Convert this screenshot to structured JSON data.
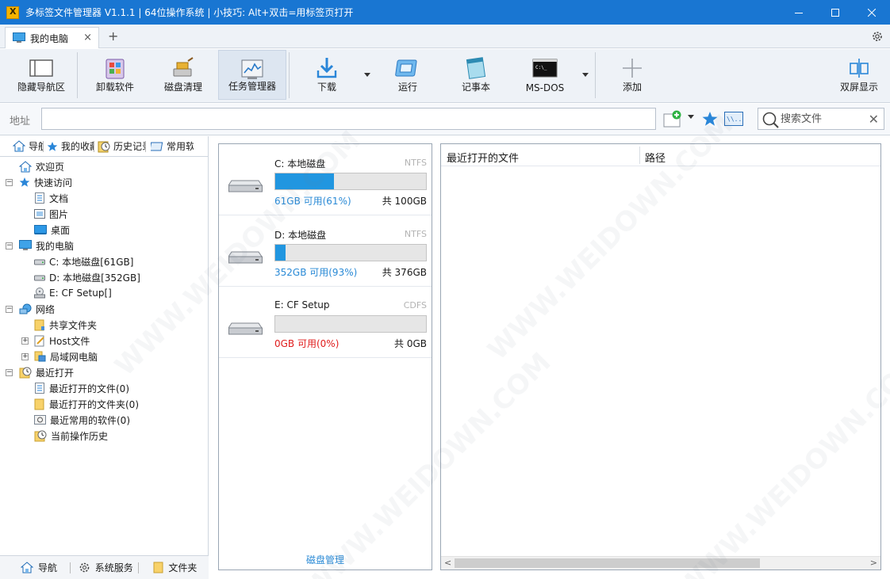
{
  "window": {
    "title": "多标签文件管理器 V1.1.1 | 64位操作系统 | 小技巧: Alt+双击=用标签页打开"
  },
  "tabs": [
    {
      "label": "我的电脑",
      "icon": "computer-icon",
      "close": "×"
    }
  ],
  "tab_add": "+",
  "toolbar": {
    "items": [
      {
        "label": "隐藏导航区",
        "icon": "hide-nav-icon"
      },
      {
        "label": "卸载软件",
        "icon": "uninstall-icon"
      },
      {
        "label": "磁盘清理",
        "icon": "disk-cleanup-icon"
      },
      {
        "label": "任务管理器",
        "icon": "task-manager-icon"
      },
      {
        "label": "下载",
        "icon": "download-icon"
      },
      {
        "label": "运行",
        "icon": "run-icon"
      },
      {
        "label": "记事本",
        "icon": "notepad-icon"
      },
      {
        "label": "MS-DOS",
        "icon": "cmd-icon"
      },
      {
        "label": "添加",
        "icon": "add-icon"
      },
      {
        "label": "双屏显示",
        "icon": "dual-screen-icon"
      }
    ]
  },
  "address": {
    "label": "地址",
    "value": ""
  },
  "search": {
    "placeholder": "搜索文件"
  },
  "nav_tabs": [
    {
      "label": "导航",
      "icon": "home-icon"
    },
    {
      "label": "我的收藏",
      "icon": "star-icon"
    },
    {
      "label": "历史记录",
      "icon": "clock-icon"
    },
    {
      "label": "常用软件",
      "icon": "app-icon"
    }
  ],
  "tree": [
    {
      "label": "欢迎页",
      "icon": "home-icon"
    },
    {
      "label": "快速访问",
      "icon": "star-icon"
    },
    {
      "label": "文档",
      "icon": "document-icon"
    },
    {
      "label": "图片",
      "icon": "picture-icon"
    },
    {
      "label": "桌面",
      "icon": "desktop-icon"
    },
    {
      "label": "我的电脑",
      "icon": "computer-icon"
    },
    {
      "label": "C: 本地磁盘[61GB]",
      "icon": "drive-icon"
    },
    {
      "label": "D: 本地磁盘[352GB]",
      "icon": "drive-icon"
    },
    {
      "label": "E: CF Setup[]",
      "icon": "cd-drive-icon"
    },
    {
      "label": "网络",
      "icon": "network-icon"
    },
    {
      "label": "共享文件夹",
      "icon": "folder-icon"
    },
    {
      "label": "Host文件",
      "icon": "edit-file-icon"
    },
    {
      "label": "局域网电脑",
      "icon": "lan-icon"
    },
    {
      "label": "最近打开",
      "icon": "recent-icon"
    },
    {
      "label": "最近打开的文件(0)",
      "icon": "document-icon"
    },
    {
      "label": "最近打开的文件夹(0)",
      "icon": "folder-icon"
    },
    {
      "label": "最近常用的软件(0)",
      "icon": "app-icon"
    },
    {
      "label": "当前操作历史",
      "icon": "history-icon"
    }
  ],
  "bottom_tabs": [
    {
      "label": "导航",
      "icon": "home-icon"
    },
    {
      "label": "系统服务",
      "icon": "gear-icon"
    },
    {
      "label": "文件夹",
      "icon": "folder-icon"
    }
  ],
  "disks": [
    {
      "name": "C: 本地磁盘",
      "fs": "NTFS",
      "free": "61GB 可用(61%)",
      "total": "共 100GB",
      "used_fraction": 0.39
    },
    {
      "name": "D: 本地磁盘",
      "fs": "NTFS",
      "free": "352GB 可用(93%)",
      "total": "共 376GB",
      "used_fraction": 0.07
    },
    {
      "name": "E: CF Setup",
      "fs": "CDFS",
      "free": "0GB 可用(0%)",
      "total": "共 0GB",
      "used_fraction": 0
    }
  ],
  "disk_manage_label": "磁盘管理",
  "recent": {
    "columns": [
      "最近打开的文件",
      "路径"
    ]
  },
  "watermark": "WWW.WEIDOWN.COM",
  "colors": {
    "titlebar": "#1976d2",
    "accent": "#2196e0",
    "free_text": "#2a8ad6",
    "zero_text": "#e01c1c"
  }
}
